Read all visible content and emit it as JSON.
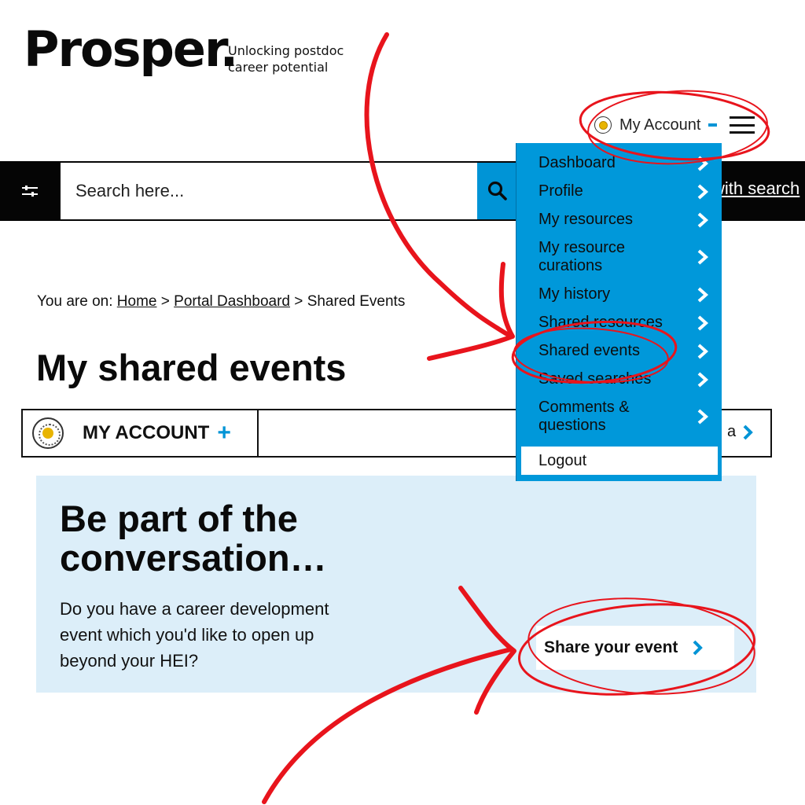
{
  "brand": {
    "logo_text": "Prosper.",
    "tagline_line1": "Unlocking postdoc",
    "tagline_line2": "career potential"
  },
  "header": {
    "account_label": "My Account",
    "menu_icon": "hamburger-icon",
    "account_icon": "sun-icon"
  },
  "search": {
    "placeholder": "Search here...",
    "advanced_label": "with search",
    "filter_icon": "sliders-icon",
    "search_icon": "magnifier-icon"
  },
  "breadcrumb": {
    "prefix": "You are on:",
    "home": "Home",
    "sep1": ">",
    "portal": "Portal Dashboard",
    "sep2": ">",
    "current": "Shared Events"
  },
  "page": {
    "title": "My shared events"
  },
  "account_bar": {
    "label": "MY ACCOUNT",
    "plus": "+",
    "right_text": "a"
  },
  "panel": {
    "title_line1": "Be part of the",
    "title_line2": "conversation…",
    "text": "Do you have a career development event which you'd like to open up beyond your HEI?",
    "button_label": "Share your event"
  },
  "dropdown": {
    "items": [
      {
        "label": "Dashboard"
      },
      {
        "label": "Profile"
      },
      {
        "label": "My resources"
      },
      {
        "label_line1": "My resource",
        "label_line2": "curations"
      },
      {
        "label": "My history"
      },
      {
        "label": "Shared resources"
      },
      {
        "label": "Shared events"
      },
      {
        "label": "Saved searches"
      },
      {
        "label_line1": "Comments &",
        "label_line2": "questions"
      }
    ],
    "logout": "Logout"
  },
  "colors": {
    "accent_blue": "#0098da",
    "panel_bg": "#dceef9",
    "annotation_red": "#e8141c",
    "search_bar": "#050505"
  }
}
